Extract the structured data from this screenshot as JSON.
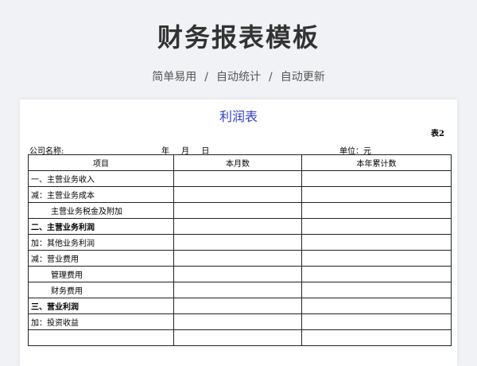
{
  "header": {
    "title": "财务报表模板",
    "subtitle_parts": [
      "简单易用",
      "自动统计",
      "自动更新"
    ],
    "separator": "/"
  },
  "sheet": {
    "title": "利润表",
    "code": "表2",
    "company_label": "公司名称:",
    "date_label": "年 月 日",
    "unit_label": "单位：元",
    "columns": [
      "项目",
      "本月数",
      "本年累计数"
    ],
    "rows": [
      {
        "label": "一、主营业务收入",
        "style": "normal"
      },
      {
        "label": "减：主营业务成本",
        "style": "normal"
      },
      {
        "label": "主营业务税金及附加",
        "style": "indent"
      },
      {
        "label": "二、主营业务利润",
        "style": "bold"
      },
      {
        "label": "加：其他业务利润",
        "style": "normal"
      },
      {
        "label": "减：营业费用",
        "style": "normal"
      },
      {
        "label": "管理费用",
        "style": "indent"
      },
      {
        "label": "财务费用",
        "style": "indent"
      },
      {
        "label": "三、营业利润",
        "style": "bold"
      },
      {
        "label": "加：投资收益",
        "style": "normal"
      },
      {
        "label": "",
        "style": "normal"
      }
    ]
  }
}
